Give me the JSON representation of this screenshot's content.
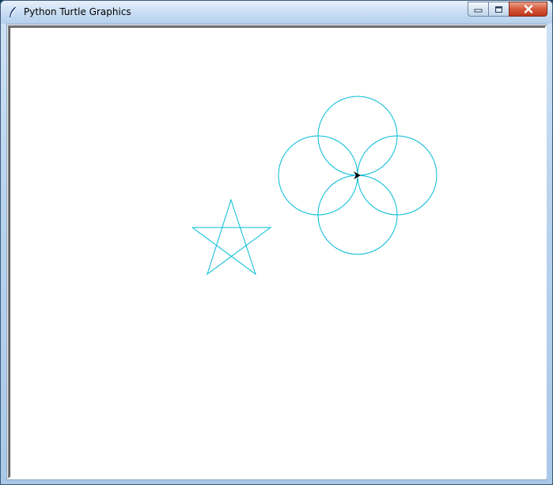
{
  "window": {
    "title": "Python Turtle Graphics",
    "icon": "feather-icon"
  },
  "titlebar_buttons": {
    "minimize": "minimize-icon",
    "maximize": "maximize-icon",
    "close": "close-icon"
  },
  "canvas": {
    "background": "#ffffff",
    "pen_color": "#00bcd8",
    "drawings": [
      {
        "shape": "star",
        "points": 5
      },
      {
        "shape": "circle",
        "count": 4
      }
    ],
    "turtle": {
      "shape": "arrow",
      "color": "#000000",
      "heading_deg": 0
    }
  }
}
